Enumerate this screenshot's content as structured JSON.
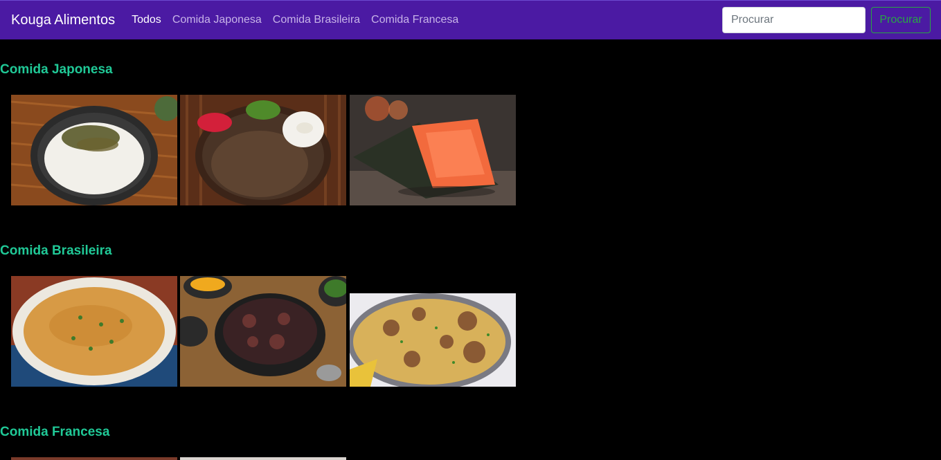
{
  "navbar": {
    "brand": "Kouga Alimentos",
    "links": [
      "Todos",
      "Comida Japonesa",
      "Comida Brasileira",
      "Comida Francesa"
    ],
    "search_placeholder": "Procurar",
    "search_button": "Procurar"
  },
  "sections": [
    {
      "title": "Comida Japonesa"
    },
    {
      "title": "Comida Brasileira"
    },
    {
      "title": "Comida Francesa"
    }
  ],
  "colors": {
    "navbar_bg": "#4b1aa3",
    "section_title": "#20c997",
    "search_button": "#28a745",
    "page_bg": "#000000"
  }
}
